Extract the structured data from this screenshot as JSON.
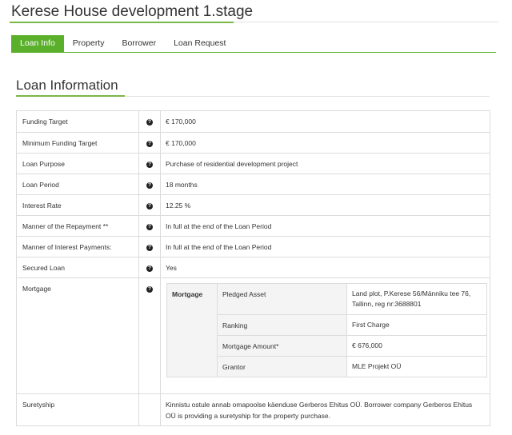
{
  "page": {
    "title": "Kerese House development 1.stage"
  },
  "tabs": [
    {
      "label": "Loan Info",
      "active": true
    },
    {
      "label": "Property",
      "active": false
    },
    {
      "label": "Borrower",
      "active": false
    },
    {
      "label": "Loan Request",
      "active": false
    }
  ],
  "section": {
    "title": "Loan Information"
  },
  "rows": [
    {
      "label": "Funding Target",
      "value": "€ 170,000"
    },
    {
      "label": "Minimum Funding Target",
      "value": "€ 170,000"
    },
    {
      "label": "Loan Purpose",
      "value": "Purchase of residential development project"
    },
    {
      "label": "Loan Period",
      "value": "18 months"
    },
    {
      "label": "Interest Rate",
      "value": "12.25 %"
    },
    {
      "label": "Manner of the Repayment **",
      "value": "In full at the end of the Loan Period"
    },
    {
      "label": "Manner of Interest Payments:",
      "value": "In full at the end of the Loan Period"
    },
    {
      "label": "Secured Loan",
      "value": "Yes"
    }
  ],
  "mortgage": {
    "label": "Mortgage",
    "header": "Mortgage",
    "rows": [
      {
        "key": "Pledged Asset",
        "value": "Land plot, P.Kerese 56/Männiku tee 76, Tallinn, reg nr:3688801"
      },
      {
        "key": "Ranking",
        "value": "First Charge"
      },
      {
        "key": "Mortgage Amount*",
        "value": "€ 676,000"
      },
      {
        "key": "Grantor",
        "value": "MLE Projekt OÜ"
      }
    ]
  },
  "suretyship": {
    "label": "Suretyship",
    "value": "Kinnistu ostule annab omapoolse käenduse Gerberos Ehitus OÜ. Borrower company Gerberos Ehitus OÜ is providing a suretyship for the property purchase."
  },
  "icons": {
    "help": "question-circle-icon",
    "glyph": "?"
  },
  "colors": {
    "accent": "#5bb02b",
    "accent_line": "#7ab648",
    "border": "#dcdcdc"
  }
}
